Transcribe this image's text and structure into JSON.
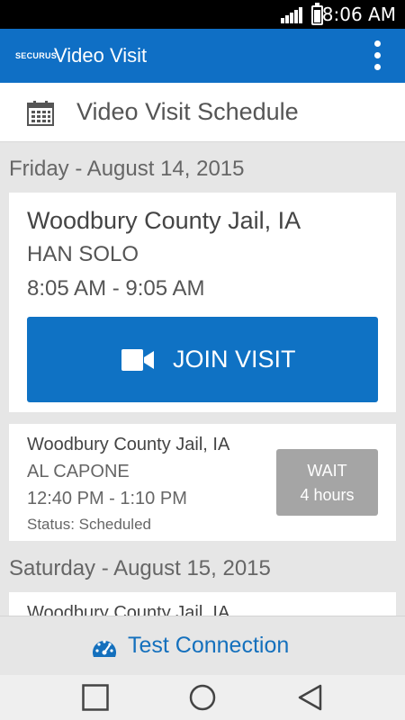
{
  "status_bar": {
    "time": "8:06 AM"
  },
  "app_bar": {
    "brand": "SECURUS",
    "title": "Video Visit"
  },
  "page": {
    "title": "Video Visit Schedule"
  },
  "schedule": [
    {
      "date": "Friday - August 14, 2015",
      "visits": [
        {
          "location": "Woodbury County Jail, IA",
          "inmate": "HAN SOLO",
          "time": "8:05 AM - 9:05 AM",
          "action": "JOIN VISIT"
        },
        {
          "location": "Woodbury County Jail, IA",
          "inmate": "AL CAPONE",
          "time": "12:40 PM - 1:10 PM",
          "status": "Status: Scheduled",
          "wait_label": "WAIT",
          "wait_time": "4 hours"
        }
      ]
    },
    {
      "date": "Saturday - August 15, 2015",
      "visits": [
        {
          "location": "Woodbury County Jail, IA"
        }
      ]
    }
  ],
  "footer": {
    "test_connection": "Test Connection"
  },
  "colors": {
    "primary": "#0f6fc5",
    "button": "#0f72c4",
    "wait": "#a5a5a5",
    "link": "#1470bd"
  }
}
